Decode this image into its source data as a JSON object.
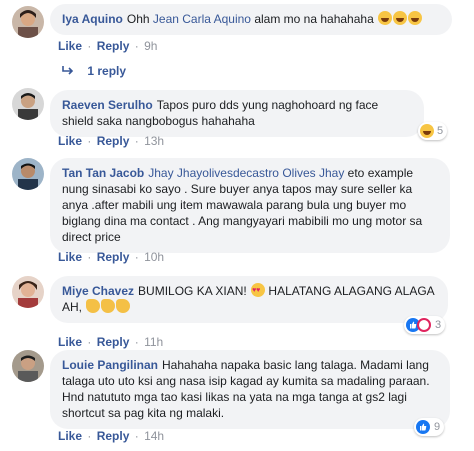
{
  "comments": [
    {
      "author": "Iya Aquino",
      "text_pre": "Ohh ",
      "mention": "Jean Carla Aquino",
      "text_post": " alam mo na hahahaha",
      "like": "Like",
      "reply": "Reply",
      "time": "9h",
      "emoji": [
        "laugh-emoji",
        "laugh-emoji",
        "laugh-emoji"
      ]
    },
    {
      "author": "Raeven Serulho",
      "text": "Tapos puro dds yung naghohoard ng face shield saka nangbobogus hahahaha",
      "like": "Like",
      "reply": "Reply",
      "time": "13h",
      "reaction_count": "5"
    },
    {
      "author": "Tan Tan Jacob",
      "mention": "Jhay Jhayolivesdecastro Olives Jhay",
      "text": " eto example nung sinasabi ko sayo . Sure buyer anya tapos may sure seller ka anya .after mabili ung item mawawala parang bula ung buyer mo biglang dina ma contact . Ang mangyayari mabibili mo ung motor sa direct price",
      "like": "Like",
      "reply": "Reply",
      "time": "10h"
    },
    {
      "author": "Miye Chavez",
      "text_pre": "BUMILOG KA XIAN! ",
      "text_mid": " HALATANG ALAGANG ALAGA AH, ",
      "like": "Like",
      "reply": "Reply",
      "time": "11h",
      "reaction_count": "3"
    },
    {
      "author": "Louie Pangilinan",
      "text": "Hahahaha napaka basic lang talaga. Madami lang talaga uto uto ksi ang nasa isip kagad ay kumita sa madaling paraan. Hnd natututo mga tao kasi likas na yata na mga tanga at gs2 lagi shortcut sa pag kita ng malaki.",
      "like": "Like",
      "reply": "Reply",
      "time": "14h",
      "reaction_count": "9"
    }
  ],
  "replies_link": "1 reply",
  "separator": "·"
}
